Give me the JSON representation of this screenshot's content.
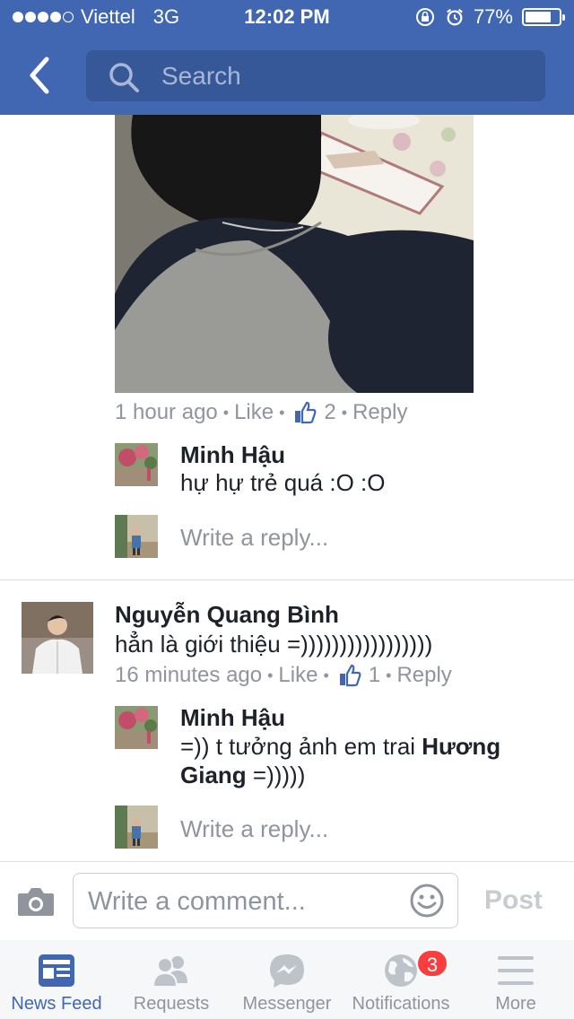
{
  "status_bar": {
    "carrier": "Viettel",
    "network": "3G",
    "time": "12:02 PM",
    "battery": "77%",
    "battery_level": 0.77,
    "signal_bars": 4
  },
  "header": {
    "search": {
      "placeholder": "Search"
    },
    "colors": {
      "brand": "#4267b2",
      "search_bg": "#365899"
    }
  },
  "comments": [
    {
      "photo": "man-writing-photo",
      "meta": {
        "time": "1 hour ago",
        "like": "Like",
        "likes_count": "2",
        "reply": "Reply"
      },
      "replies": [
        {
          "author": "Minh Hậu",
          "text": "hự hự trẻ quá :O :O"
        }
      ],
      "reply_placeholder": "Write a reply..."
    },
    {
      "author": "Nguyễn Quang Bình",
      "text": "hẳn là giới thiệu =)))))))))))))))))",
      "meta": {
        "time": "16 minutes ago",
        "like": "Like",
        "likes_count": "1",
        "reply": "Reply"
      },
      "replies": [
        {
          "author": "Minh Hậu",
          "text_part1": "=)) t tưởng ảnh em trai ",
          "text_bold_1": "Hương",
          "text_bold_2": "Giang",
          "text_part2": " =)))))"
        }
      ],
      "reply_placeholder": "Write a reply..."
    }
  ],
  "composer": {
    "placeholder": "Write a comment...",
    "post_label": "Post"
  },
  "tabbar": {
    "tabs": [
      {
        "label": "News Feed",
        "icon": "news-feed-icon",
        "active": true
      },
      {
        "label": "Requests",
        "icon": "friend-requests-icon"
      },
      {
        "label": "Messenger",
        "icon": "messenger-icon"
      },
      {
        "label": "Notifications",
        "icon": "globe-icon",
        "badge": "3"
      },
      {
        "label": "More",
        "icon": "hamburger-menu-icon"
      }
    ]
  }
}
